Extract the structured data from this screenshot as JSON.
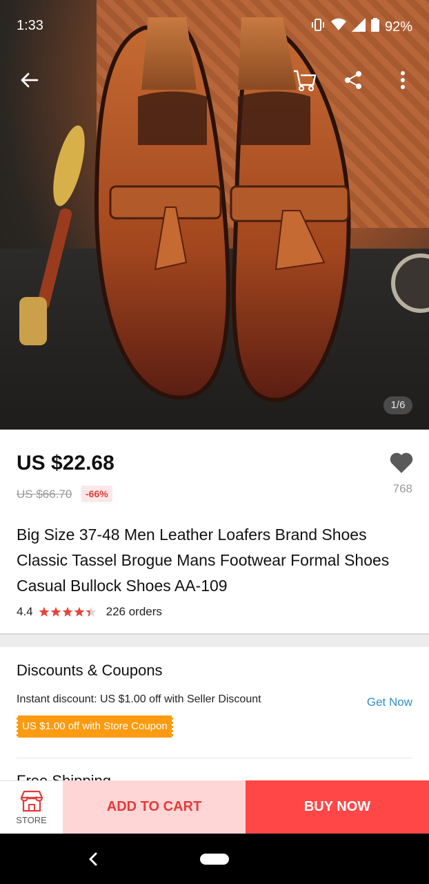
{
  "status_bar": {
    "time": "1:33",
    "battery": "92%"
  },
  "hero": {
    "image_counter": "1/6"
  },
  "product": {
    "price": "US $22.68",
    "original_price": "US $66.70",
    "discount_badge": "-66%",
    "wishlist_count": "768",
    "title": "Big Size 37-48 Men Leather Loafers Brand Shoes Classic Tassel Brogue Mans Footwear Formal Shoes Casual Bullock Shoes AA-109",
    "rating": "4.4",
    "rating_stars": 4.4,
    "orders": "226 orders"
  },
  "discounts": {
    "title": "Discounts & Coupons",
    "instant": "Instant discount: US $1.00 off with Seller Discount",
    "get_now": "Get Now",
    "coupon": "US $1.00 off with Store Coupon"
  },
  "next_section": {
    "title": "Free Shipping"
  },
  "action_bar": {
    "store_label": "STORE",
    "add_to_cart": "ADD TO CART",
    "buy_now": "BUY NOW"
  },
  "colors": {
    "accent_red": "#ff4747",
    "cart_bg": "#ffd6d6",
    "coupon_orange": "#fa9b12",
    "link_blue": "#2f8fc8",
    "star_red": "#e4453a"
  },
  "icons": [
    "back-arrow-icon",
    "cart-icon",
    "share-icon",
    "more-vert-icon",
    "heart-icon",
    "store-icon",
    "nav-back-icon"
  ]
}
